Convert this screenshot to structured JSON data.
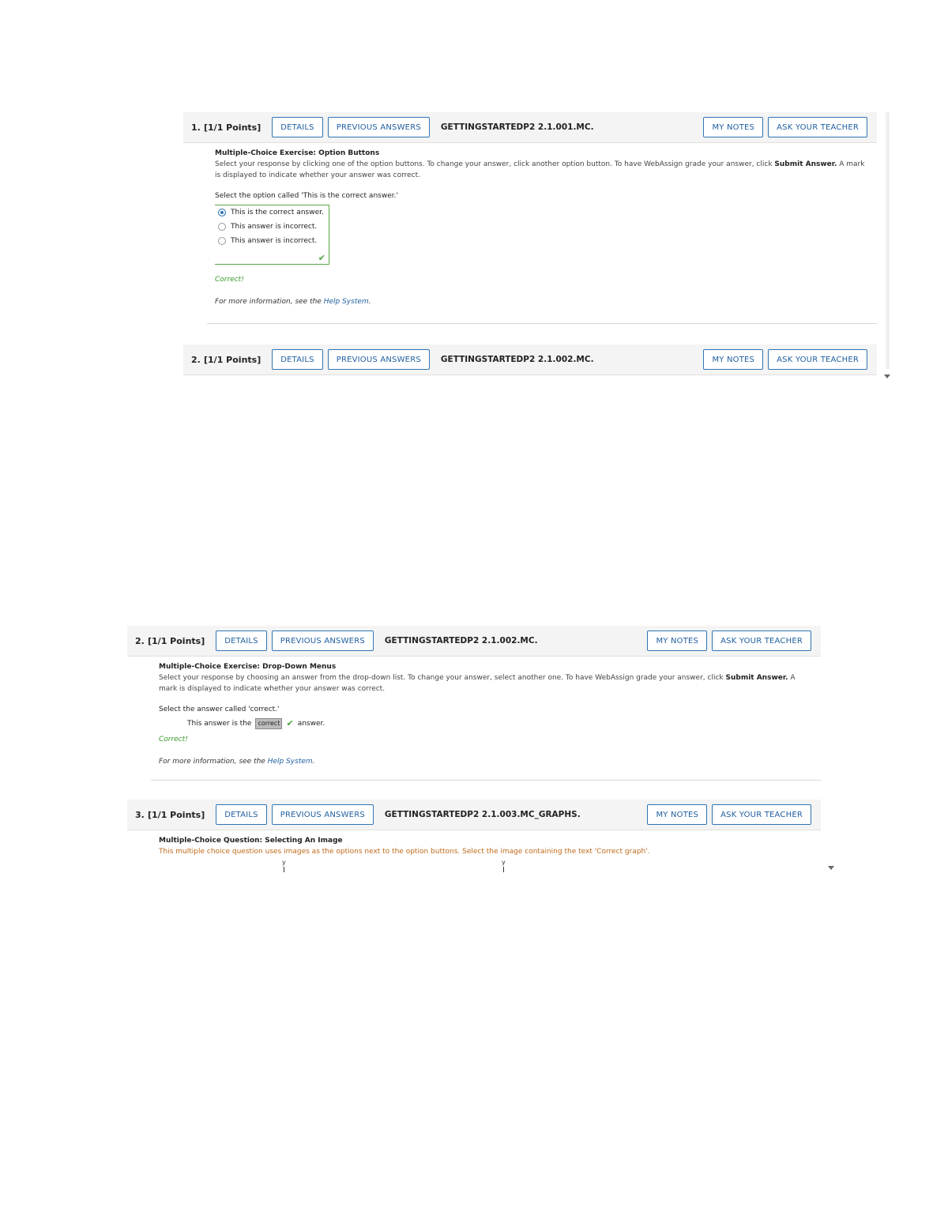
{
  "common": {
    "details_label": "DETAILS",
    "previous_answers_label": "PREVIOUS ANSWERS",
    "my_notes_label": "MY NOTES",
    "ask_teacher_label": "ASK YOUR TEACHER",
    "correct_label": "Correct!",
    "more_info_prefix": "For more information, see the",
    "help_link": "Help System",
    "more_info_suffix": "."
  },
  "q1": {
    "number": "1.",
    "points": "[1/1 Points]",
    "code": "GETTINGSTARTEDP2 2.1.001.MC.",
    "title": "Multiple-Choice Exercise: Option Buttons",
    "desc_pre": "Select your response by clicking one of the option buttons. To change your answer, click another option button. To have WebAssign grade your answer, click",
    "desc_bold": "Submit Answer.",
    "desc_post": "A mark is displayed to indicate whether your answer was correct.",
    "prompt": "Select the option called 'This is the correct answer.'",
    "options": [
      "This is the correct answer.",
      "This answer is incorrect.",
      "This answer is incorrect."
    ],
    "selected_index": 0
  },
  "q2": {
    "number": "2.",
    "points": "[1/1 Points]",
    "code": "GETTINGSTARTEDP2 2.1.002.MC.",
    "title": "Multiple-Choice Exercise: Drop-Down Menus",
    "desc_pre": "Select your response by choosing an answer from the drop-down list. To change your answer, select another one. To have WebAssign grade your answer, click",
    "desc_bold": "Submit Answer.",
    "desc_post": "A mark is displayed to indicate whether your answer was correct.",
    "prompt": "Select the answer called 'correct.'",
    "answer_pre": "This answer is the",
    "answer_selected": "correct",
    "answer_post": "answer."
  },
  "q3": {
    "number": "3.",
    "points": "[1/1 Points]",
    "code": "GETTINGSTARTEDP2 2.1.003.MC_GRAPHS.",
    "title": "Multiple-Choice Question: Selecting An Image",
    "desc": "This multiple choice question uses images as the options next to the option buttons. Select the image containing the text 'Correct graph'.",
    "tick_label": "y"
  }
}
